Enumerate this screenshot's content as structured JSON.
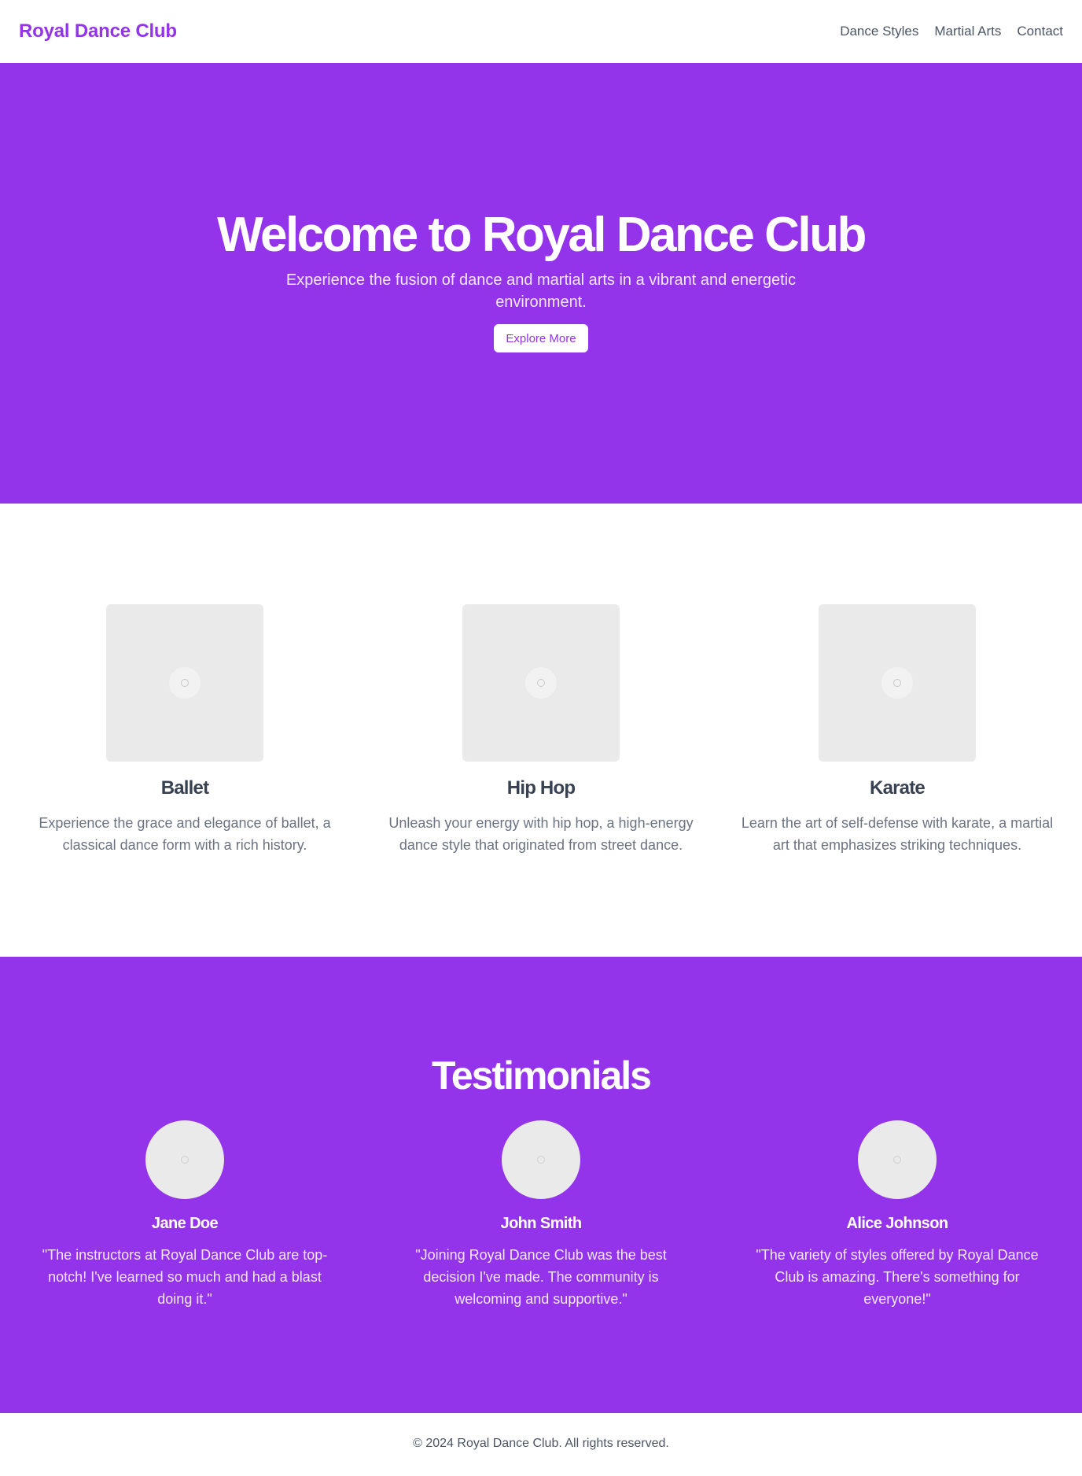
{
  "header": {
    "brand": "Royal Dance Club",
    "nav": [
      "Dance Styles",
      "Martial Arts",
      "Contact"
    ]
  },
  "hero": {
    "title": "Welcome to Royal Dance Club",
    "subtitle": "Experience the fusion of dance and martial arts in a vibrant and energetic environment.",
    "button_label": "Explore More"
  },
  "features": [
    {
      "title": "Ballet",
      "description": "Experience the grace and elegance of ballet, a classical dance form with a rich history.",
      "image_icon": "image-placeholder-icon"
    },
    {
      "title": "Hip Hop",
      "description": "Unleash your energy with hip hop, a high-energy dance style that originated from street dance.",
      "image_icon": "image-placeholder-icon"
    },
    {
      "title": "Karate",
      "description": "Learn the art of self-defense with karate, a martial art that emphasizes striking techniques.",
      "image_icon": "image-placeholder-icon"
    }
  ],
  "testimonials": {
    "title": "Testimonials",
    "items": [
      {
        "name": "Jane Doe",
        "quote": "\"The instructors at Royal Dance Club are top-notch! I've learned so much and had a blast doing it.\""
      },
      {
        "name": "John Smith",
        "quote": "\"Joining Royal Dance Club was the best decision I've made. The community is welcoming and supportive.\""
      },
      {
        "name": "Alice Johnson",
        "quote": "\"The variety of styles offered by Royal Dance Club is amazing. There's something for everyone!\""
      }
    ]
  },
  "footer": {
    "copyright": "© 2024 Royal Dance Club. All rights reserved."
  },
  "colors": {
    "primary": "#9333ea",
    "text_dark": "#374151",
    "text_muted": "#6b7280",
    "placeholder": "#eaeaea"
  }
}
